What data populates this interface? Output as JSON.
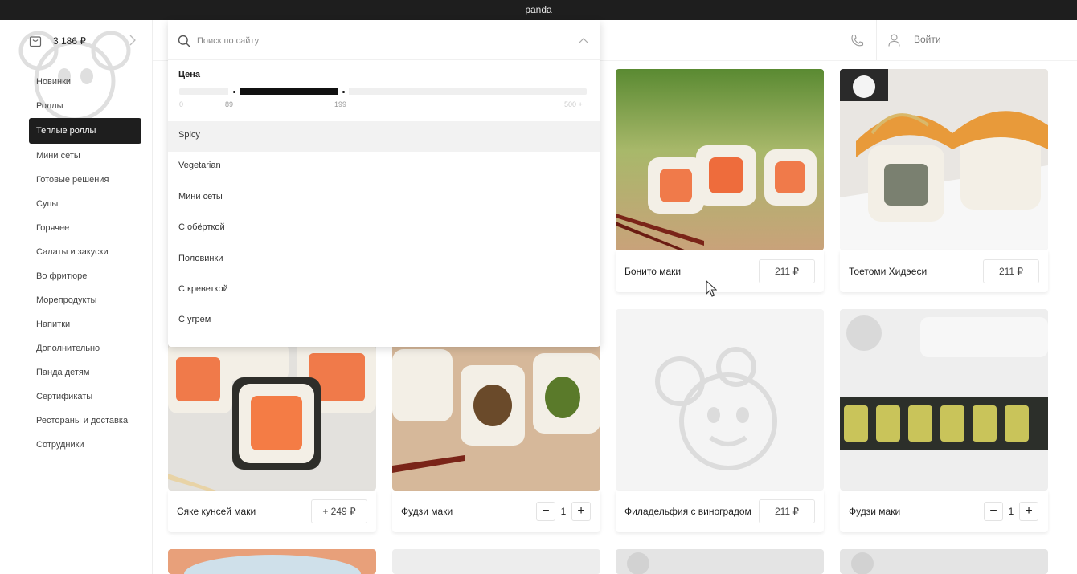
{
  "window": {
    "title": "panda"
  },
  "cart": {
    "total": "3 186 ₽"
  },
  "nav": {
    "items": [
      "Новинки",
      "Роллы",
      "Теплые роллы",
      "Мини сеты",
      "Готовые решения",
      "Супы",
      "Горячее",
      "Салаты и закуски",
      "Во фритюре",
      "Морепродукты",
      "Напитки",
      "Дополнительно",
      "Панда детям",
      "Сертификаты",
      "Рестораны и доставка",
      "Сотрудники"
    ],
    "active_index": 2
  },
  "header": {
    "login_label": "Войти"
  },
  "search": {
    "placeholder": "Поиск по сайту",
    "price": {
      "title": "Цена",
      "min_label": "0",
      "low_label": "89",
      "high_label": "199",
      "max_label": "500 +",
      "range_min": 0,
      "range_max": 500,
      "selected_low": 89,
      "selected_high": 199
    },
    "tags": [
      "Spicy",
      "Vegetarian",
      "Мини сеты",
      "С обёрткой",
      "Половинки",
      "С креветкой",
      "С угрем"
    ],
    "hovered_tag_index": 0
  },
  "products": [
    {
      "name": "Бонито маки",
      "price": "211 ₽"
    },
    {
      "name": "Тоетоми Хидэеси",
      "price": "211 ₽"
    },
    {
      "name": "Сяке кунсей маки",
      "price": "+ 249 ₽"
    },
    {
      "name": "Фудзи маки",
      "quantity": "1",
      "minus": "−",
      "plus": "+"
    },
    {
      "name": "Филадельфия с виноградом",
      "price": "211 ₽"
    },
    {
      "name": "Фудзи маки",
      "quantity": "1",
      "minus": "−",
      "plus": "+"
    }
  ],
  "colors": {
    "accent": "#1e1e1e",
    "titlebar": "#1e1e1e",
    "salmon": "#f07a4a",
    "rice": "#f3efe6"
  }
}
